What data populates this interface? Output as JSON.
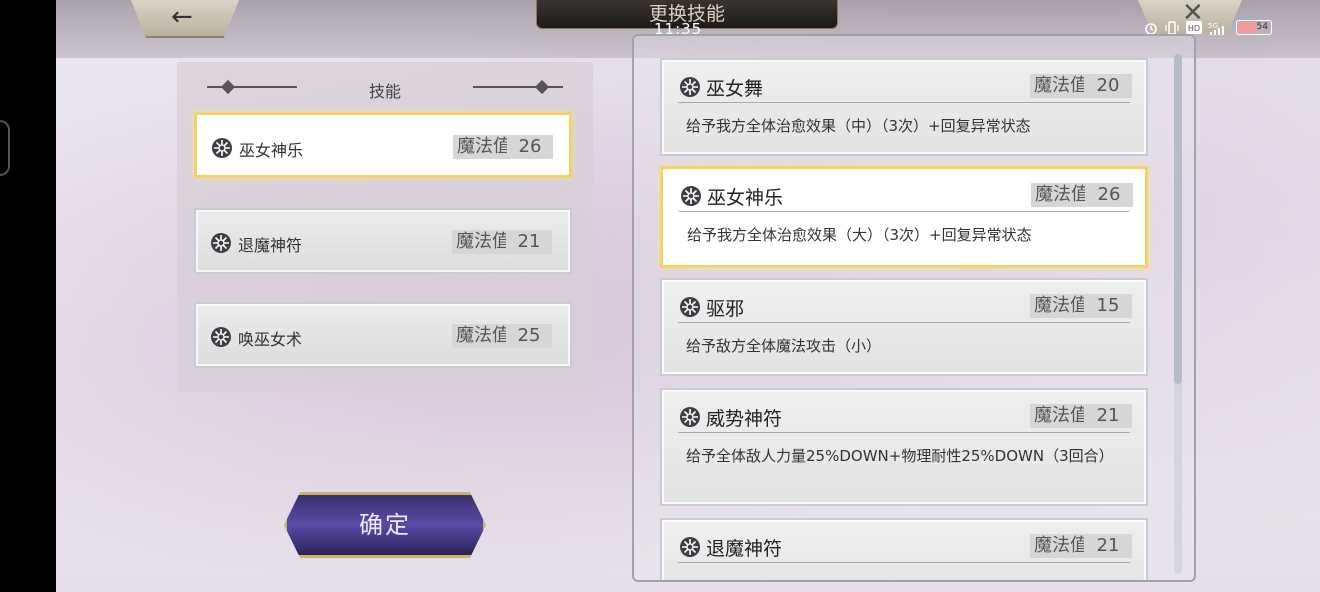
{
  "status_bar": {
    "time": "11:35",
    "icons": [
      "alarm-icon",
      "vibrate-icon",
      "hd-icon",
      "signal-5g-icon"
    ],
    "battery_level": "54"
  },
  "header": {
    "title": "更换技能",
    "back_icon": "←",
    "close_icon": "✕"
  },
  "left_panel": {
    "title": "技能",
    "slots": [
      {
        "name": "巫女神乐",
        "mp_label": "魔法值",
        "mp": "26"
      },
      {
        "name": "退魔神符",
        "mp_label": "魔法值",
        "mp": "21"
      },
      {
        "name": "唤巫女术",
        "mp_label": "魔法值",
        "mp": "25"
      }
    ]
  },
  "confirm_label": "确定",
  "skill_list": [
    {
      "name": "巫女舞",
      "mp_label": "魔法值",
      "mp": "20",
      "desc": "给予我方全体治愈效果（中）（3次）+回复异常状态"
    },
    {
      "name": "巫女神乐",
      "mp_label": "魔法值",
      "mp": "26",
      "desc": "给予我方全体治愈效果（大）（3次）+回复异常状态"
    },
    {
      "name": "驱邪",
      "mp_label": "魔法值",
      "mp": "15",
      "desc": "给予敌方全体魔法攻击（小）"
    },
    {
      "name": "威势神符",
      "mp_label": "魔法值",
      "mp": "21",
      "desc": "给予全体敌人力量25%DOWN+物理耐性25%DOWN（3回合）"
    },
    {
      "name": "退魔神符",
      "mp_label": "魔法值",
      "mp": "21",
      "desc": ""
    }
  ]
}
